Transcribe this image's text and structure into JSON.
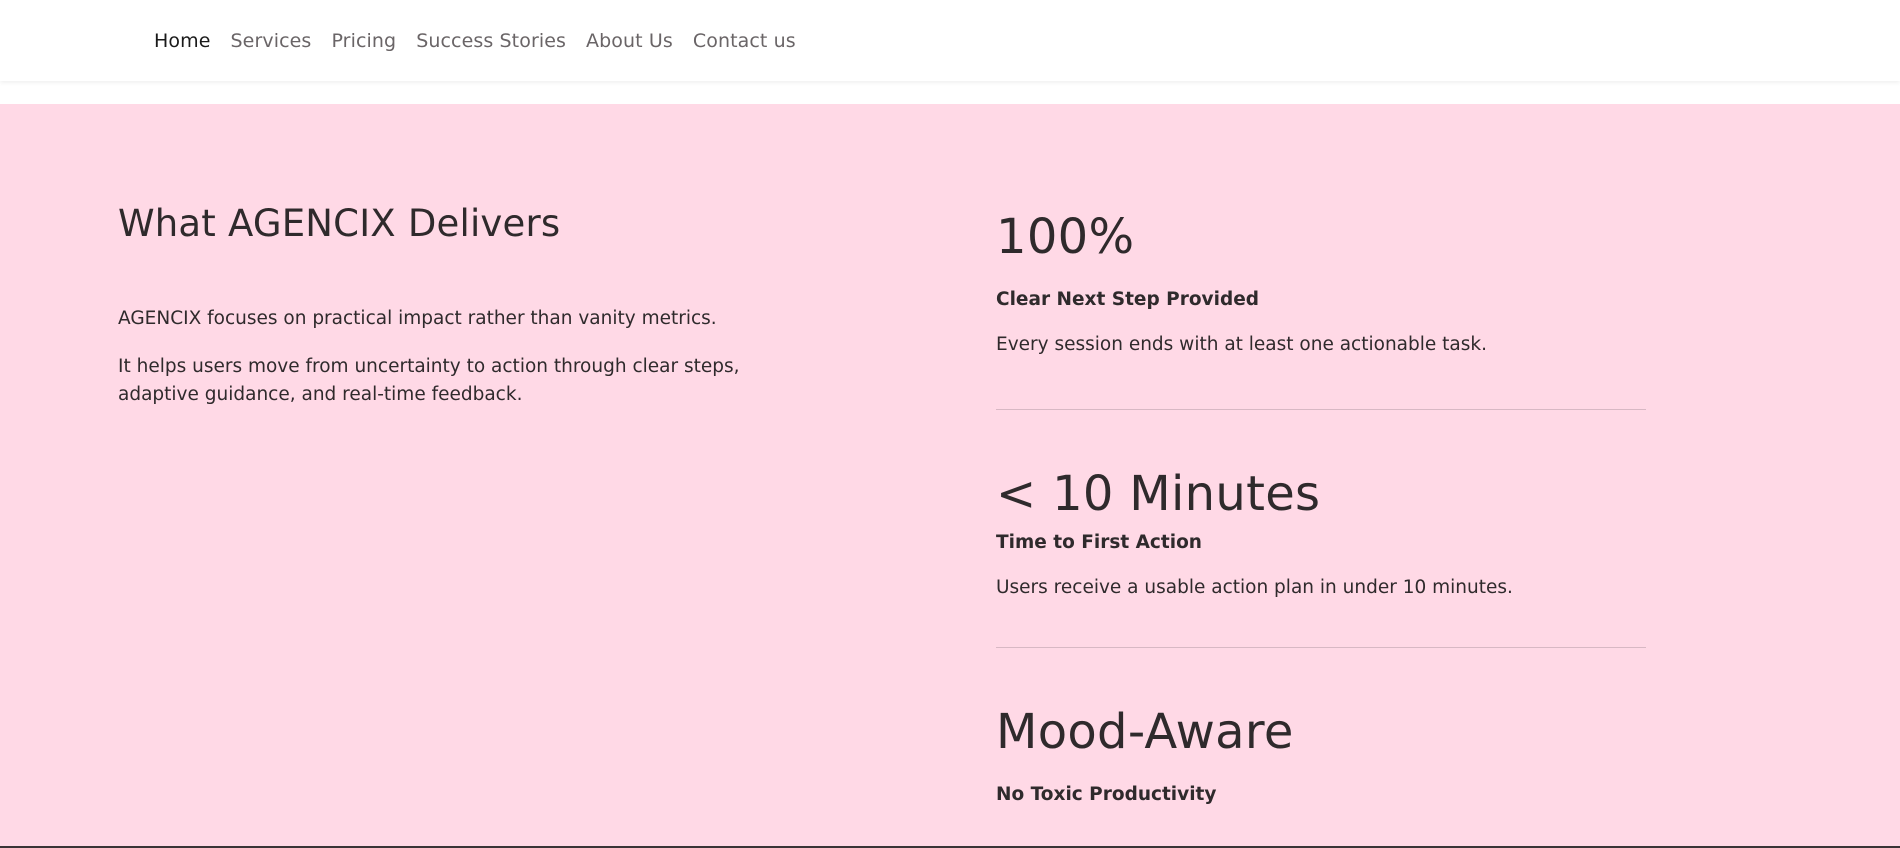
{
  "nav": {
    "items": [
      {
        "label": "Home",
        "active": true
      },
      {
        "label": "Services",
        "active": false
      },
      {
        "label": "Pricing",
        "active": false
      },
      {
        "label": "Success Stories",
        "active": false
      },
      {
        "label": "About Us",
        "active": false
      },
      {
        "label": "Contact us",
        "active": false
      }
    ]
  },
  "intro": {
    "heading": "What AGENCIX Delivers",
    "paragraph_1": "AGENCIX focuses on practical impact rather than vanity metrics.",
    "paragraph_2": "It helps users move from uncertainty to action through clear steps, adaptive guidance, and real-time feedback."
  },
  "stats": [
    {
      "value": "100%",
      "label": "Clear Next Step Provided",
      "description": "Every session ends with at least one actionable task."
    },
    {
      "value": "< 10 Minutes",
      "label": "Time to First Action",
      "description": "Users receive a usable action plan in under 10 minutes."
    },
    {
      "value": "Mood-Aware",
      "label": "No Toxic Productivity",
      "description": ""
    }
  ],
  "colors": {
    "section_background": "#ffd9e6",
    "text": "#2f2a2c",
    "nav_text": "#6a6567",
    "nav_active": "#1a1a1a"
  }
}
